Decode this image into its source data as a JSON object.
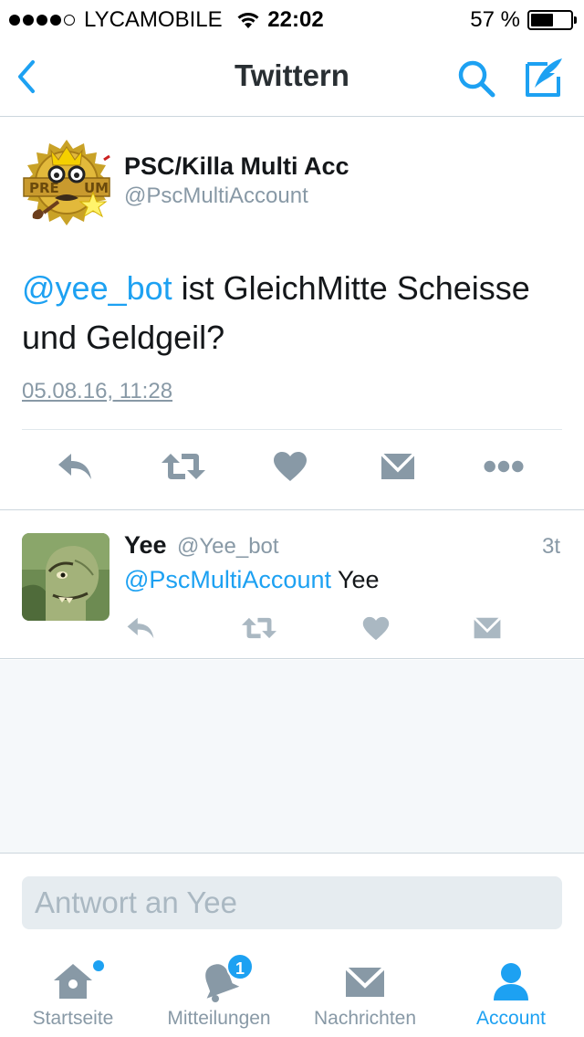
{
  "status_bar": {
    "carrier": "LYCAMOBILE",
    "time": "22:02",
    "battery_percent": "57 %",
    "battery_level": 0.57,
    "signal_bars": 4
  },
  "nav": {
    "title": "Twittern",
    "back_icon": "chevron-left-icon",
    "search_icon": "search-icon",
    "compose_icon": "compose-icon",
    "accent": "#1da1f2"
  },
  "main_tweet": {
    "name": "PSC/Killa Multi Acc",
    "handle": "@PscMultiAccount",
    "mention": "@yee_bot",
    "text": " ist  GleichMitte Scheisse und Geldgeil?",
    "timestamp": "05.08.16, 11:28",
    "actions": [
      "reply-icon",
      "retweet-icon",
      "like-icon",
      "direct-message-icon",
      "more-icon"
    ]
  },
  "reply": {
    "name": "Yee",
    "handle": "@Yee_bot",
    "time": "3t",
    "mention": "@PscMultiAccount",
    "text": " Yee",
    "actions": [
      "reply-icon",
      "retweet-icon",
      "like-icon",
      "direct-message-icon"
    ]
  },
  "reply_box": {
    "placeholder": "Antwort an Yee"
  },
  "tabbar": {
    "tabs": [
      {
        "label": "Startseite",
        "icon": "home-icon",
        "active": false,
        "has_dot": true
      },
      {
        "label": "Mitteilungen",
        "icon": "bell-icon",
        "active": false,
        "badge": "1"
      },
      {
        "label": "Nachrichten",
        "icon": "envelope-icon",
        "active": false
      },
      {
        "label": "Account",
        "icon": "person-icon",
        "active": true
      }
    ]
  },
  "colors": {
    "accent": "#1da1f2",
    "icon_gray": "#8899a6",
    "divider": "#ccd6dd",
    "empty_bg": "#f5f8fa"
  }
}
